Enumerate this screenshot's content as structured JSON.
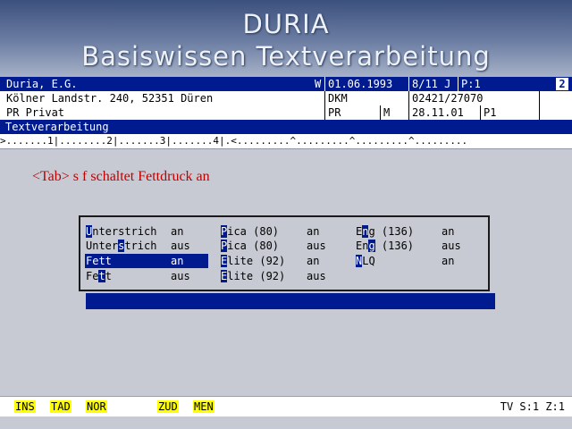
{
  "banner": {
    "line1": "DURIA",
    "line2": "Basiswissen Textverarbeitung"
  },
  "header": {
    "row1": {
      "name": "Duria, E.G.",
      "flag": "W",
      "date": "01.06.1993",
      "ref": "8/11 J",
      "page_code": "P:1",
      "page_no": "2"
    },
    "row2": {
      "address": "Kölner Landstr. 240, 52351 Düren",
      "code": "DKM",
      "phone": "02421/27070"
    },
    "row3": {
      "dept": "PR Privat",
      "code": "PR",
      "mark": "M",
      "date": "28.11.01",
      "page": "P1"
    }
  },
  "doc_title": "Textverarbeitung",
  "ruler": ">.......1|........2|.......3|.......4|.<.........^.........^.........^.........",
  "instruction": "<Tab> s f schaltet Fettdruck an",
  "menu": {
    "col1": [
      {
        "hotkey": "U",
        "rest": "nterstrich",
        "value": "an"
      },
      {
        "pre": "Unter",
        "hotkey": "s",
        "rest": "trich",
        "value": "aus"
      },
      {
        "hotkey": "F",
        "rest": "ett",
        "value": "an"
      },
      {
        "pre": "Fe",
        "hotkey": "t",
        "rest": "t",
        "value": "aus"
      }
    ],
    "col2": [
      {
        "hotkey": "P",
        "rest": "ica (80)",
        "value": "an"
      },
      {
        "hotkey": "P",
        "rest": "ica (80)",
        "value": "aus"
      },
      {
        "hotkey": "E",
        "rest": "lite (92)",
        "value": "an"
      },
      {
        "hotkey": "E",
        "rest": "lite (92)",
        "value": "aus"
      }
    ],
    "col3": [
      {
        "pre": "E",
        "hotkey": "n",
        "rest": "g (136)",
        "value": "an"
      },
      {
        "pre": "En",
        "hotkey": "g",
        "rest": " (136)",
        "value": "aus"
      },
      {
        "hotkey": "N",
        "rest": "LQ",
        "value": "an"
      }
    ]
  },
  "status": {
    "keys": [
      "INS",
      "TAD",
      "NOR",
      "ZUD",
      "MEN"
    ],
    "position": "TV S:1 Z:1"
  }
}
